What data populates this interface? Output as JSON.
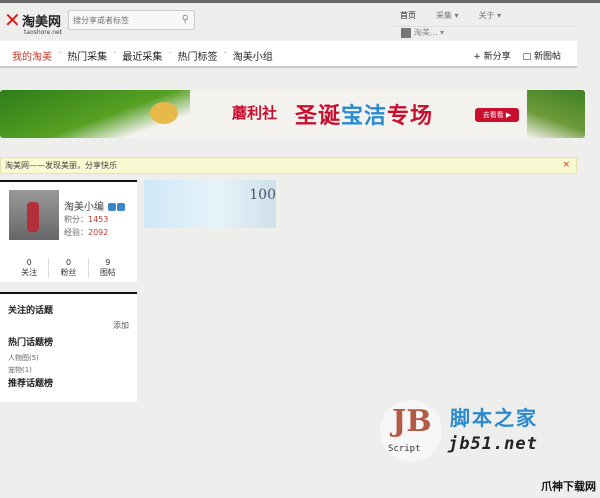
{
  "logo": {
    "name": "淘美网",
    "domain": "taoshore.net"
  },
  "search": {
    "placeholder": "搜分享或者标签"
  },
  "toplinks": [
    "首页",
    "采集 ▾",
    "关于 ▾"
  ],
  "user": {
    "name": "淘美... ▾"
  },
  "nav": {
    "items": [
      "我的淘美",
      "热门采集",
      "最近采集",
      "热门标签",
      "淘美小组"
    ],
    "new_share": "+ 新分享",
    "new_post": "□ 新图帖"
  },
  "banner": {
    "brand": "蘑利社",
    "title_a": "圣诞",
    "title_b": "宝洁",
    "title_c": "专场",
    "button": "去看看 ▶"
  },
  "notice": {
    "text": "淘美网——发现美丽，分享快乐",
    "close": "×"
  },
  "profile": {
    "name": "淘美小编",
    "points_label": "积分：",
    "points": "1453",
    "exp_label": "经验：",
    "exp": "2092",
    "stats": [
      {
        "value": "0",
        "label": "关注"
      },
      {
        "value": "0",
        "label": "粉丝"
      },
      {
        "value": "9",
        "label": "图帖"
      }
    ]
  },
  "topics": {
    "followed": "关注的话题",
    "add": "添加",
    "hot": "热门话题榜",
    "hot_items": [
      "人物图(5)",
      "宠物(1)"
    ],
    "recommended": "推荐话题榜"
  },
  "ad": {
    "text": "100"
  },
  "watermark": {
    "cn": "脚本之家",
    "en": "jb51.net",
    "logo": "JB",
    "script": "Script",
    "corner": "爪神下载网"
  }
}
